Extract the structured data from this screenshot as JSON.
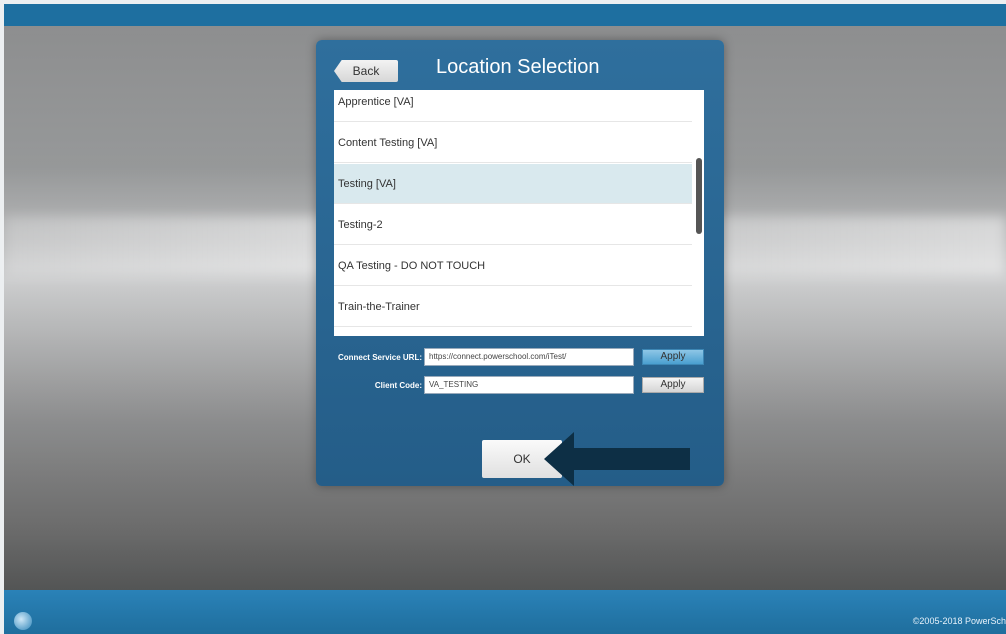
{
  "dialog": {
    "title": "Location Selection",
    "back_label": "Back",
    "ok_label": "OK"
  },
  "locations": [
    {
      "label": "Apprentice [VA]"
    },
    {
      "label": "Content Testing [VA]"
    },
    {
      "label": "Testing [VA]",
      "selected": true
    },
    {
      "label": "Testing-2"
    },
    {
      "label": "QA Testing - DO NOT TOUCH"
    },
    {
      "label": "Train-the-Trainer"
    }
  ],
  "connect_service": {
    "label": "Connect Service URL:",
    "value": "https://connect.powerschool.com/iTest/",
    "apply_label": "Apply"
  },
  "client_code": {
    "label": "Client Code:",
    "value": "VA_TESTING",
    "apply_label": "Apply"
  },
  "taskbar": {
    "copyright": "©2005-2018 PowerSch"
  },
  "icons": {
    "start": "start-orb-icon",
    "annotation_arrow": "arrow-left-icon"
  },
  "colors": {
    "dialog_bg": "#2f6f9d",
    "selected_row": "#d9e9ee",
    "apply_accent": "#4a9fd0",
    "taskbar": "#2a82b8"
  }
}
